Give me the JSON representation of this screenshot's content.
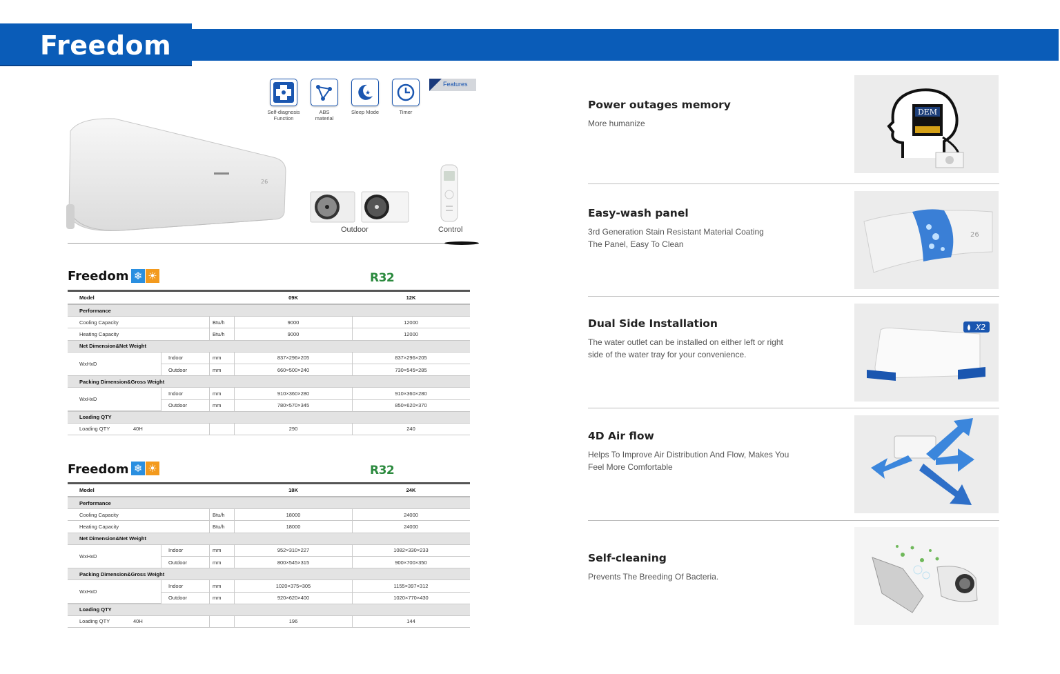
{
  "header": {
    "title": "Freedom"
  },
  "feature_icons": [
    {
      "icon": "self-diagnosis-icon",
      "label_line1": "Self-diagnosis",
      "label_line2": "Function"
    },
    {
      "icon": "abs-material-icon",
      "label_line1": "ABS",
      "label_line2": "material"
    },
    {
      "icon": "sleep-mode-icon",
      "label_line1": "Sleep Mode",
      "label_line2": ""
    },
    {
      "icon": "timer-icon",
      "label_line1": "Timer",
      "label_line2": ""
    }
  ],
  "features_tag": "Features",
  "product_captions": {
    "outdoor": "Outdoor",
    "control": "Control"
  },
  "tables": [
    {
      "title": "Freedom",
      "refrigerant": "R32",
      "header": {
        "model_label": "Model",
        "models": [
          "09K",
          "12K"
        ]
      },
      "performance_label": "Performance",
      "cooling": {
        "label": "Cooling  Capacity",
        "unit": "Btu/h",
        "values": [
          "9000",
          "12000"
        ]
      },
      "heating": {
        "label": "Heating  Capacity",
        "unit": "Btu/h",
        "values": [
          "9000",
          "12000"
        ]
      },
      "net_label": "Net Dimension&Net Weight",
      "net_dim_label": "WxHxD",
      "net_indoor": {
        "label": "Indoor",
        "unit": "mm",
        "values": [
          "837×296×205",
          "837×296×205"
        ]
      },
      "net_outdoor": {
        "label": "Outdoor",
        "unit": "mm",
        "values": [
          "660×500×240",
          "730×545×285"
        ]
      },
      "packing_label": "Packing  Dimension&Gross Weight",
      "pack_dim_label": "WxHxD",
      "pack_indoor": {
        "label": "Indoor",
        "unit": "mm",
        "values": [
          "910×360×280",
          "910×360×280"
        ]
      },
      "pack_outdoor": {
        "label": "Outdoor",
        "unit": "mm",
        "values": [
          "780×570×345",
          "850×620×370"
        ]
      },
      "loading_label": "Loading QTY",
      "loading": {
        "label": "Loading QTY",
        "container": "40H",
        "values": [
          "290",
          "240"
        ]
      }
    },
    {
      "title": "Freedom",
      "refrigerant": "R32",
      "header": {
        "model_label": "Model",
        "models": [
          "18K",
          "24K"
        ]
      },
      "performance_label": "Performance",
      "cooling": {
        "label": "Cooling  Capacity",
        "unit": "Btu/h",
        "values": [
          "18000",
          "24000"
        ]
      },
      "heating": {
        "label": "Heating  Capacity",
        "unit": "Btu/h",
        "values": [
          "18000",
          "24000"
        ]
      },
      "net_label": "Net Dimension&Net Weight",
      "net_dim_label": "WxHxD",
      "net_indoor": {
        "label": "Indoor",
        "unit": "mm",
        "values": [
          "952×310×227",
          "1082×330×233"
        ]
      },
      "net_outdoor": {
        "label": "Outdoor",
        "unit": "mm",
        "values": [
          "800×545×315",
          "900×700×350"
        ]
      },
      "packing_label": "Packing  Dimension&Gross Weight",
      "pack_dim_label": "WxHxD",
      "pack_indoor": {
        "label": "Indoor",
        "unit": "mm",
        "values": [
          "1020×375×305",
          "1155×397×312"
        ]
      },
      "pack_outdoor": {
        "label": "Outdoor",
        "unit": "mm",
        "values": [
          "920×620×400",
          "1020×770×430"
        ]
      },
      "loading_label": "Loading QTY",
      "loading": {
        "label": "Loading QTY",
        "container": "40H",
        "values": [
          "196",
          "144"
        ]
      }
    }
  ],
  "features": [
    {
      "title": "Power outages memory",
      "desc_line1": "More humanize",
      "desc_line2": "",
      "image": "power-memory-image",
      "chip_label": "DEM"
    },
    {
      "title": "Easy-wash panel",
      "desc_line1": "3rd Generation Stain Resistant Material Coating",
      "desc_line2": "The Panel, Easy To Clean",
      "image": "easy-wash-panel-image"
    },
    {
      "title": "Dual Side Installation",
      "desc_line1": "The water outlet can be installed on either left or right",
      "desc_line2": "side of the water tray for your convenience.",
      "image": "dual-side-installation-image",
      "badge": "X2"
    },
    {
      "title": "4D Air flow",
      "desc_line1": "Helps To Improve Air Distribution And Flow, Makes You",
      "desc_line2": "Feel More Comfortable",
      "image": "4d-airflow-image"
    },
    {
      "title": "Self-cleaning",
      "desc_line1": "Prevents The Breeding Of Bacteria.",
      "desc_line2": "",
      "image": "self-cleaning-image"
    }
  ],
  "colors": {
    "brand_blue": "#0a5cb8",
    "r32_green": "#2b8a3e",
    "cool_blue": "#2a8fe0",
    "heat_orange": "#f39a1d"
  }
}
